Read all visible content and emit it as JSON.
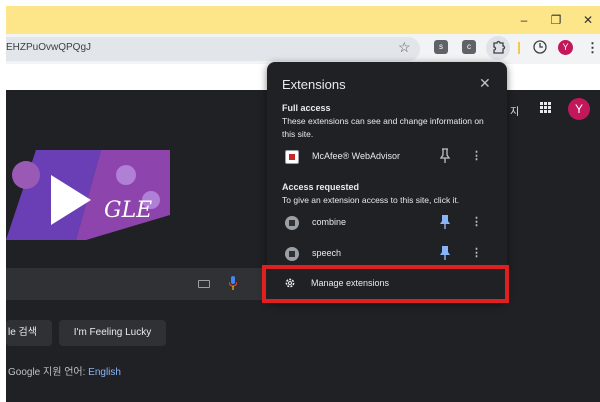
{
  "window": {
    "minimize": "–",
    "restore": "❐",
    "close": "✕"
  },
  "address_bar": {
    "url_text": "EHZPuOvwQPQgJ"
  },
  "toolbar": {
    "extension_icons": [
      {
        "icon": "s-extension-icon",
        "letter": "s"
      },
      {
        "icon": "c-extension-icon",
        "letter": "c"
      }
    ],
    "avatar_letter": "Y",
    "menu": "⋮"
  },
  "google_page": {
    "korean_link": "지",
    "avatar_letter": "Y",
    "search_button": "le 검색",
    "lucky_button": "I'm Feeling Lucky",
    "language_prefix": "Google 지원 언어: ",
    "language_link": "English",
    "doodle_text": "GLE"
  },
  "extensions_popup": {
    "title": "Extensions",
    "close": "✕",
    "full_access": {
      "heading": "Full access",
      "description": "These extensions can see and change information on this site.",
      "items": [
        {
          "name": "McAfee® WebAdvisor",
          "pinned": false
        }
      ]
    },
    "access_requested": {
      "heading": "Access requested",
      "description": "To give an extension access to this site, click it.",
      "items": [
        {
          "name": "combine",
          "pinned": true
        },
        {
          "name": "speech",
          "pinned": true
        }
      ]
    },
    "more": "⋮",
    "manage_label": "Manage extensions"
  },
  "colors": {
    "titlebar": "#fde68a",
    "page_bg": "#202124",
    "pin_active": "#8ab4f8",
    "highlight": "#e02020",
    "avatar": "#c2185b"
  }
}
